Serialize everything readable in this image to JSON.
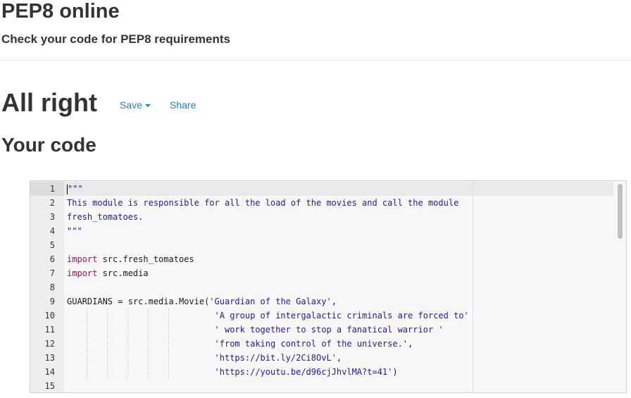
{
  "header": {
    "title": "PEP8 online",
    "subtitle": "Check your code for PEP8 requirements"
  },
  "result": {
    "heading": "All right",
    "save_label": "Save",
    "share_label": "Share"
  },
  "code_section": {
    "heading": "Your code"
  },
  "editor": {
    "active_line": 1,
    "lines": [
      {
        "number": "1",
        "tokens": [
          {
            "type": "str",
            "text": "\"\"\""
          }
        ]
      },
      {
        "number": "2",
        "tokens": [
          {
            "type": "str",
            "text": "This module is responsible for all the load of the movies and call the module"
          }
        ]
      },
      {
        "number": "3",
        "tokens": [
          {
            "type": "str",
            "text": "fresh_tomatoes."
          }
        ]
      },
      {
        "number": "4",
        "tokens": [
          {
            "type": "str",
            "text": "\"\"\""
          }
        ]
      },
      {
        "number": "5",
        "tokens": []
      },
      {
        "number": "6",
        "tokens": [
          {
            "type": "kw",
            "text": "import"
          },
          {
            "type": "plain",
            "text": " src.fresh_tomatoes"
          }
        ]
      },
      {
        "number": "7",
        "tokens": [
          {
            "type": "kw",
            "text": "import"
          },
          {
            "type": "plain",
            "text": " src.media"
          }
        ]
      },
      {
        "number": "8",
        "tokens": []
      },
      {
        "number": "9",
        "tokens": [
          {
            "type": "plain",
            "text": "GUARDIANS = src.media.Movie("
          },
          {
            "type": "str",
            "text": "'Guardian of the Galaxy'"
          },
          {
            "type": "plain",
            "text": ","
          }
        ]
      },
      {
        "number": "10",
        "tokens": [
          {
            "type": "plain",
            "text": "                             "
          },
          {
            "type": "str",
            "text": "'A group of intergalactic criminals are forced to'"
          }
        ]
      },
      {
        "number": "11",
        "tokens": [
          {
            "type": "plain",
            "text": "                             "
          },
          {
            "type": "str",
            "text": "' work together to stop a fanatical warrior '"
          }
        ]
      },
      {
        "number": "12",
        "tokens": [
          {
            "type": "plain",
            "text": "                             "
          },
          {
            "type": "str",
            "text": "'from taking control of the universe.'"
          },
          {
            "type": "plain",
            "text": ","
          }
        ]
      },
      {
        "number": "13",
        "tokens": [
          {
            "type": "plain",
            "text": "                             "
          },
          {
            "type": "str",
            "text": "'https://bit.ly/2Ci8OvL'"
          },
          {
            "type": "plain",
            "text": ","
          }
        ]
      },
      {
        "number": "14",
        "tokens": [
          {
            "type": "plain",
            "text": "                             "
          },
          {
            "type": "str",
            "text": "'https://youtu.be/d96cjJhvlMA?t=41'"
          },
          {
            "type": "plain",
            "text": ")"
          }
        ]
      },
      {
        "number": "15",
        "tokens": []
      }
    ]
  },
  "colors": {
    "link": "#1e7fc1",
    "string": "#1a1aa6",
    "keyword": "#93135b",
    "heading": "#333333"
  }
}
